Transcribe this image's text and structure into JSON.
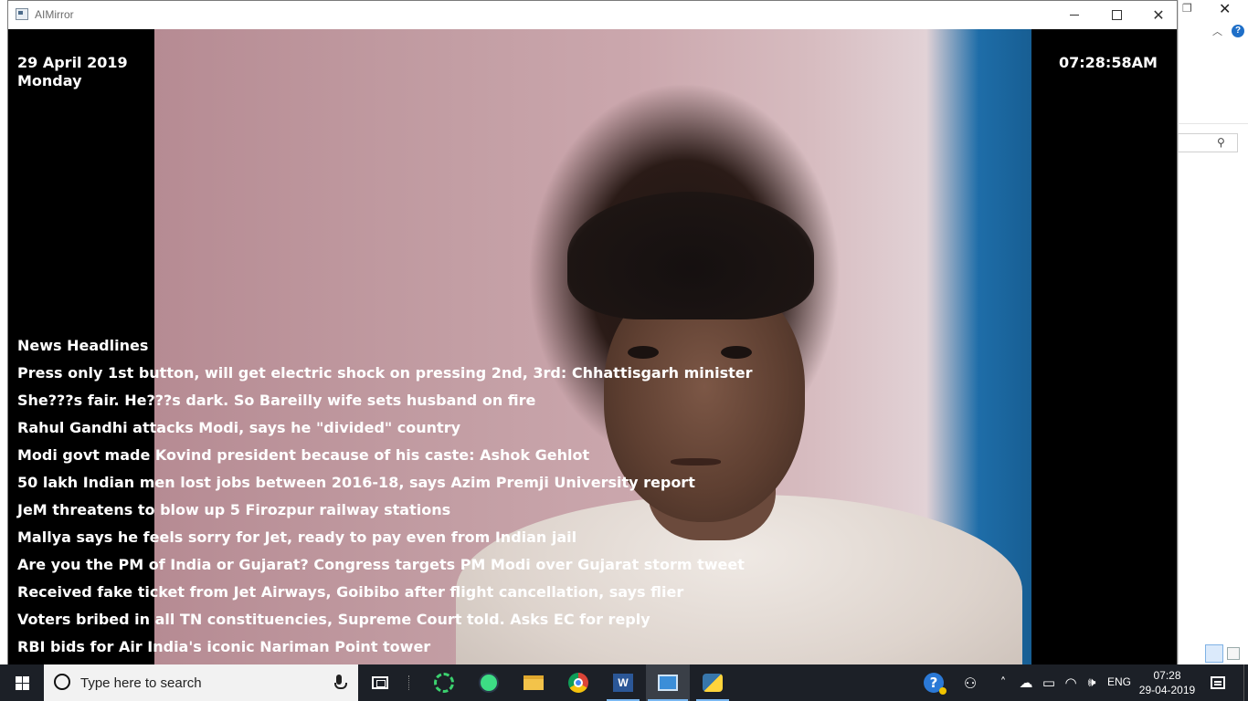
{
  "window": {
    "title": "AIMirror",
    "minimize_symbol": "",
    "maximize_symbol": "",
    "close_symbol": "✕"
  },
  "mirror": {
    "date": "29 April 2019",
    "day": "Monday",
    "time": "07:28:58AM",
    "news_heading": "News Headlines",
    "headlines": [
      "Press only 1st button, will get electric shock on pressing 2nd, 3rd: Chhattisgarh minister",
      "She???s fair. He???s dark. So Bareilly wife sets husband on fire",
      "Rahul Gandhi attacks Modi, says he \"divided\" country",
      "Modi govt made Kovind president because of his caste: Ashok Gehlot",
      "50 lakh Indian men lost jobs between 2016-18, says Azim Premji University report",
      "JeM threatens to blow up 5 Firozpur railway stations",
      "Mallya says he feels sorry for Jet, ready to pay even from Indian jail",
      "Are you the PM of India or Gujarat? Congress targets PM Modi over Gujarat storm tweet",
      "Received fake ticket from Jet Airways, Goibibo after flight cancellation, says flier",
      "Voters bribed in all TN constituencies, Supreme Court told. Asks EC for reply",
      "RBI bids for Air India's iconic Nariman Point tower"
    ]
  },
  "background_window": {
    "restore_symbol": "❐",
    "close_symbol": "✕",
    "chevron_symbol": "︿",
    "help_symbol": "?",
    "search_symbol": "⚲"
  },
  "taskbar": {
    "search_placeholder": "Type here to search",
    "word_letter": "W",
    "help_symbol": "?",
    "people_symbol": "⚇",
    "chevron_symbol": "˄",
    "cloud_symbol": "☁",
    "battery_symbol": "▭",
    "wifi_symbol": "◠",
    "volume_symbol": "🕪",
    "language": "ENG",
    "time": "07:28",
    "date": "29-04-2019",
    "accent_color": "#7ab8f2",
    "background_color": "#1c2027"
  }
}
